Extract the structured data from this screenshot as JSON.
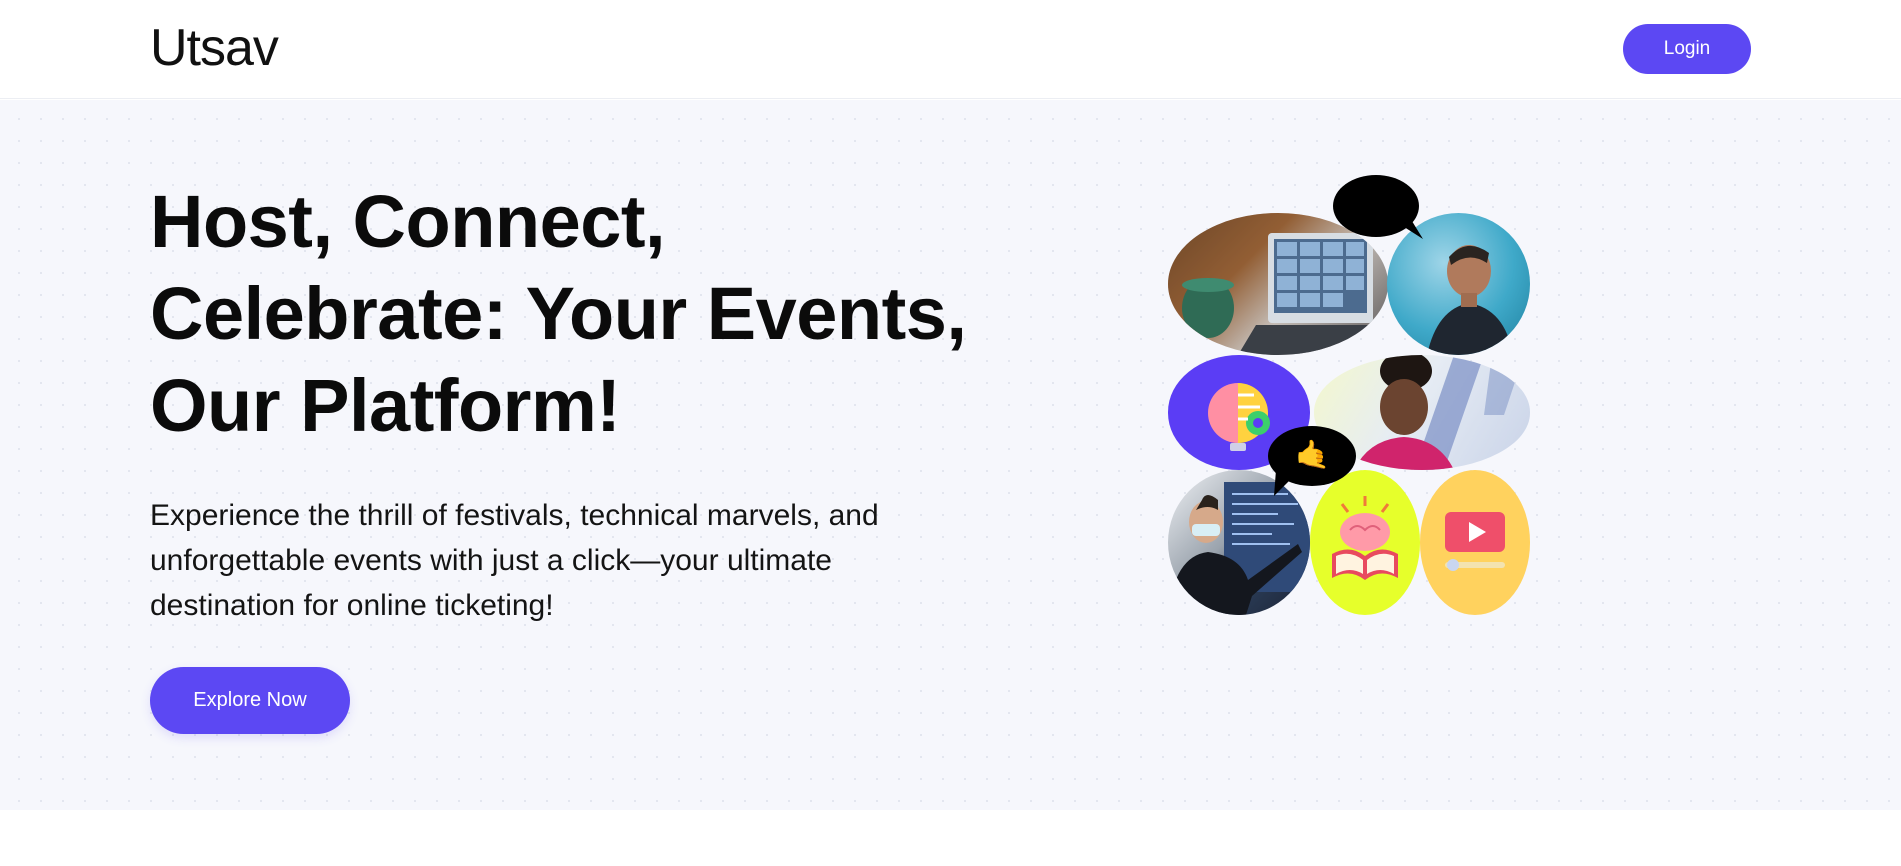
{
  "header": {
    "logo_text": "Utsav",
    "login_label": "Login"
  },
  "hero": {
    "title": "Host, Connect, Celebrate: Your Events, Our Platform!",
    "subtitle": "Experience the thrill of festivals, technical marvels, and unforgettable events with just a click—your ultimate destination for online ticketing!",
    "cta_label": "Explore Now"
  },
  "collage": {
    "tiles": [
      {
        "name": "laptop-video-call-photo"
      },
      {
        "name": "smiling-man-photo"
      },
      {
        "name": "brain-lightbulb-icon"
      },
      {
        "name": "smiling-woman-photo"
      },
      {
        "name": "presenter-photo"
      },
      {
        "name": "brain-book-icon"
      },
      {
        "name": "video-play-icon"
      }
    ],
    "bubbles": [
      {
        "name": "heart-eyes-emoji-bubble",
        "emoji": "😍"
      },
      {
        "name": "hand-emoji-bubble",
        "emoji": "🤙"
      }
    ]
  },
  "colors": {
    "accent": "#5c48f3",
    "hero_bg": "#f6f7fc",
    "text": "#0b0b0b",
    "tile_purple": "#5b3df5",
    "tile_lime": "#e6ff2b",
    "tile_yellow": "#ffd25e"
  }
}
